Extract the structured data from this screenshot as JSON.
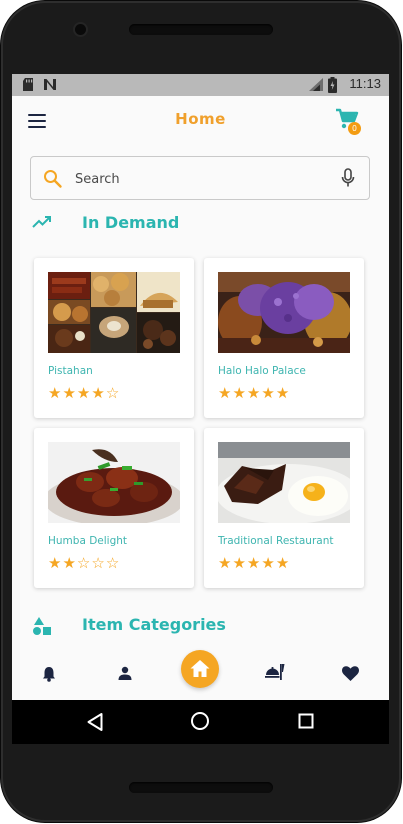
{
  "status_bar": {
    "time": "11:13"
  },
  "app_bar": {
    "title": "Home",
    "cart_count": "0"
  },
  "search": {
    "placeholder": "Search"
  },
  "sections": {
    "in_demand": "In Demand",
    "item_categories": "Item Categories"
  },
  "restaurants": [
    {
      "name": "Pistahan",
      "rating": 4,
      "max_rating": 5
    },
    {
      "name": "Halo Halo Palace",
      "rating": 5,
      "max_rating": 5
    },
    {
      "name": "Humba Delight",
      "rating": 2,
      "max_rating": 5
    },
    {
      "name": "Traditional Restaurant",
      "rating": 5,
      "max_rating": 5
    }
  ],
  "bottom_nav": [
    {
      "icon": "bell-icon"
    },
    {
      "icon": "person-icon"
    },
    {
      "icon": "home-icon",
      "active": true
    },
    {
      "icon": "dining-icon"
    },
    {
      "icon": "heart-icon"
    }
  ],
  "colors": {
    "accent_orange": "#f5a623",
    "teal": "#2bb5b0",
    "navy_icon": "#1c2541"
  }
}
